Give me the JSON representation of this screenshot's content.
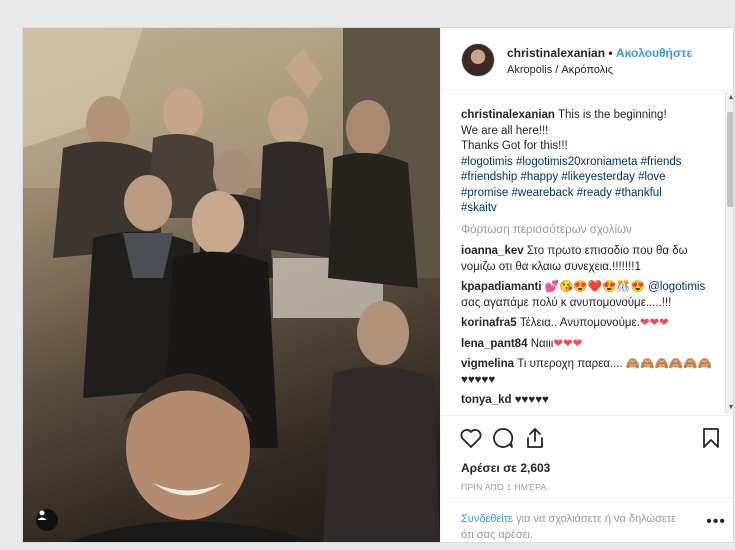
{
  "header": {
    "username": "christinalexanian",
    "separator": "•",
    "follow_label": "Ακολουθήστε",
    "location": "Akropolis / Ακρόπολις"
  },
  "caption": {
    "username": "christinalexanian",
    "line1": "This is the beginning!",
    "line2": "We are all here!!!",
    "line3": "Thanks Got for this!!!",
    "hashtags_1": "#logotimis #logotimis20xroniameta #friends",
    "hashtags_2": "#friendship #happy #likeyesterday #love",
    "hashtags_3": "#promise #weareback #ready #thankful",
    "hashtags_4": "#skaitv"
  },
  "load_more_label": "Φόρτωση περισσότερων σχολίων",
  "comments": [
    {
      "user": "ioanna_kev",
      "text": "Στο πρωτο επισοδιο που θα δω νομιζω οτι θα κλαιω συνεχεια.!!!!!!!1"
    },
    {
      "user": "kpapadiamanti",
      "emoji": "💕😘😍❤️😍🎊😍",
      "mention": "@logotimis",
      "text": "σας αγαπάμε πολύ κ ανυπομονούμε.....!!!"
    },
    {
      "user": "korinafra5",
      "text": "Τέλεια.. Ανυπομονούμε.",
      "hearts": "❤❤❤"
    },
    {
      "user": "lena_pant84",
      "text": "Ναιιι",
      "hearts": "❤❤❤"
    },
    {
      "user": "vigmelina",
      "text": "Τι υπεροχη παρεα.... 🙈🙈🙈🙈🙈🙈♥♥♥♥♥"
    },
    {
      "user": "tonya_kd",
      "text": "♥♥♥♥♥"
    }
  ],
  "likes": "Αρέσει σε 2,603",
  "timestamp": "ΠΡΙΝ ΑΠΌ 1 ΗΜΈΡΑ",
  "login_prompt": {
    "link": "Συνδεθείτε",
    "rest": "για να σχολιάσετε ή να δηλώσετε ότι σας αρέσει."
  },
  "more_label": "•••",
  "icons": [
    "heart-icon",
    "comment-icon",
    "share-icon",
    "bookmark-icon",
    "user-tag-icon",
    "more-options-icon"
  ],
  "colors": {
    "link": "#3897f0",
    "hashtag": "#003569",
    "muted": "#999999",
    "heart": "#ed4956"
  }
}
